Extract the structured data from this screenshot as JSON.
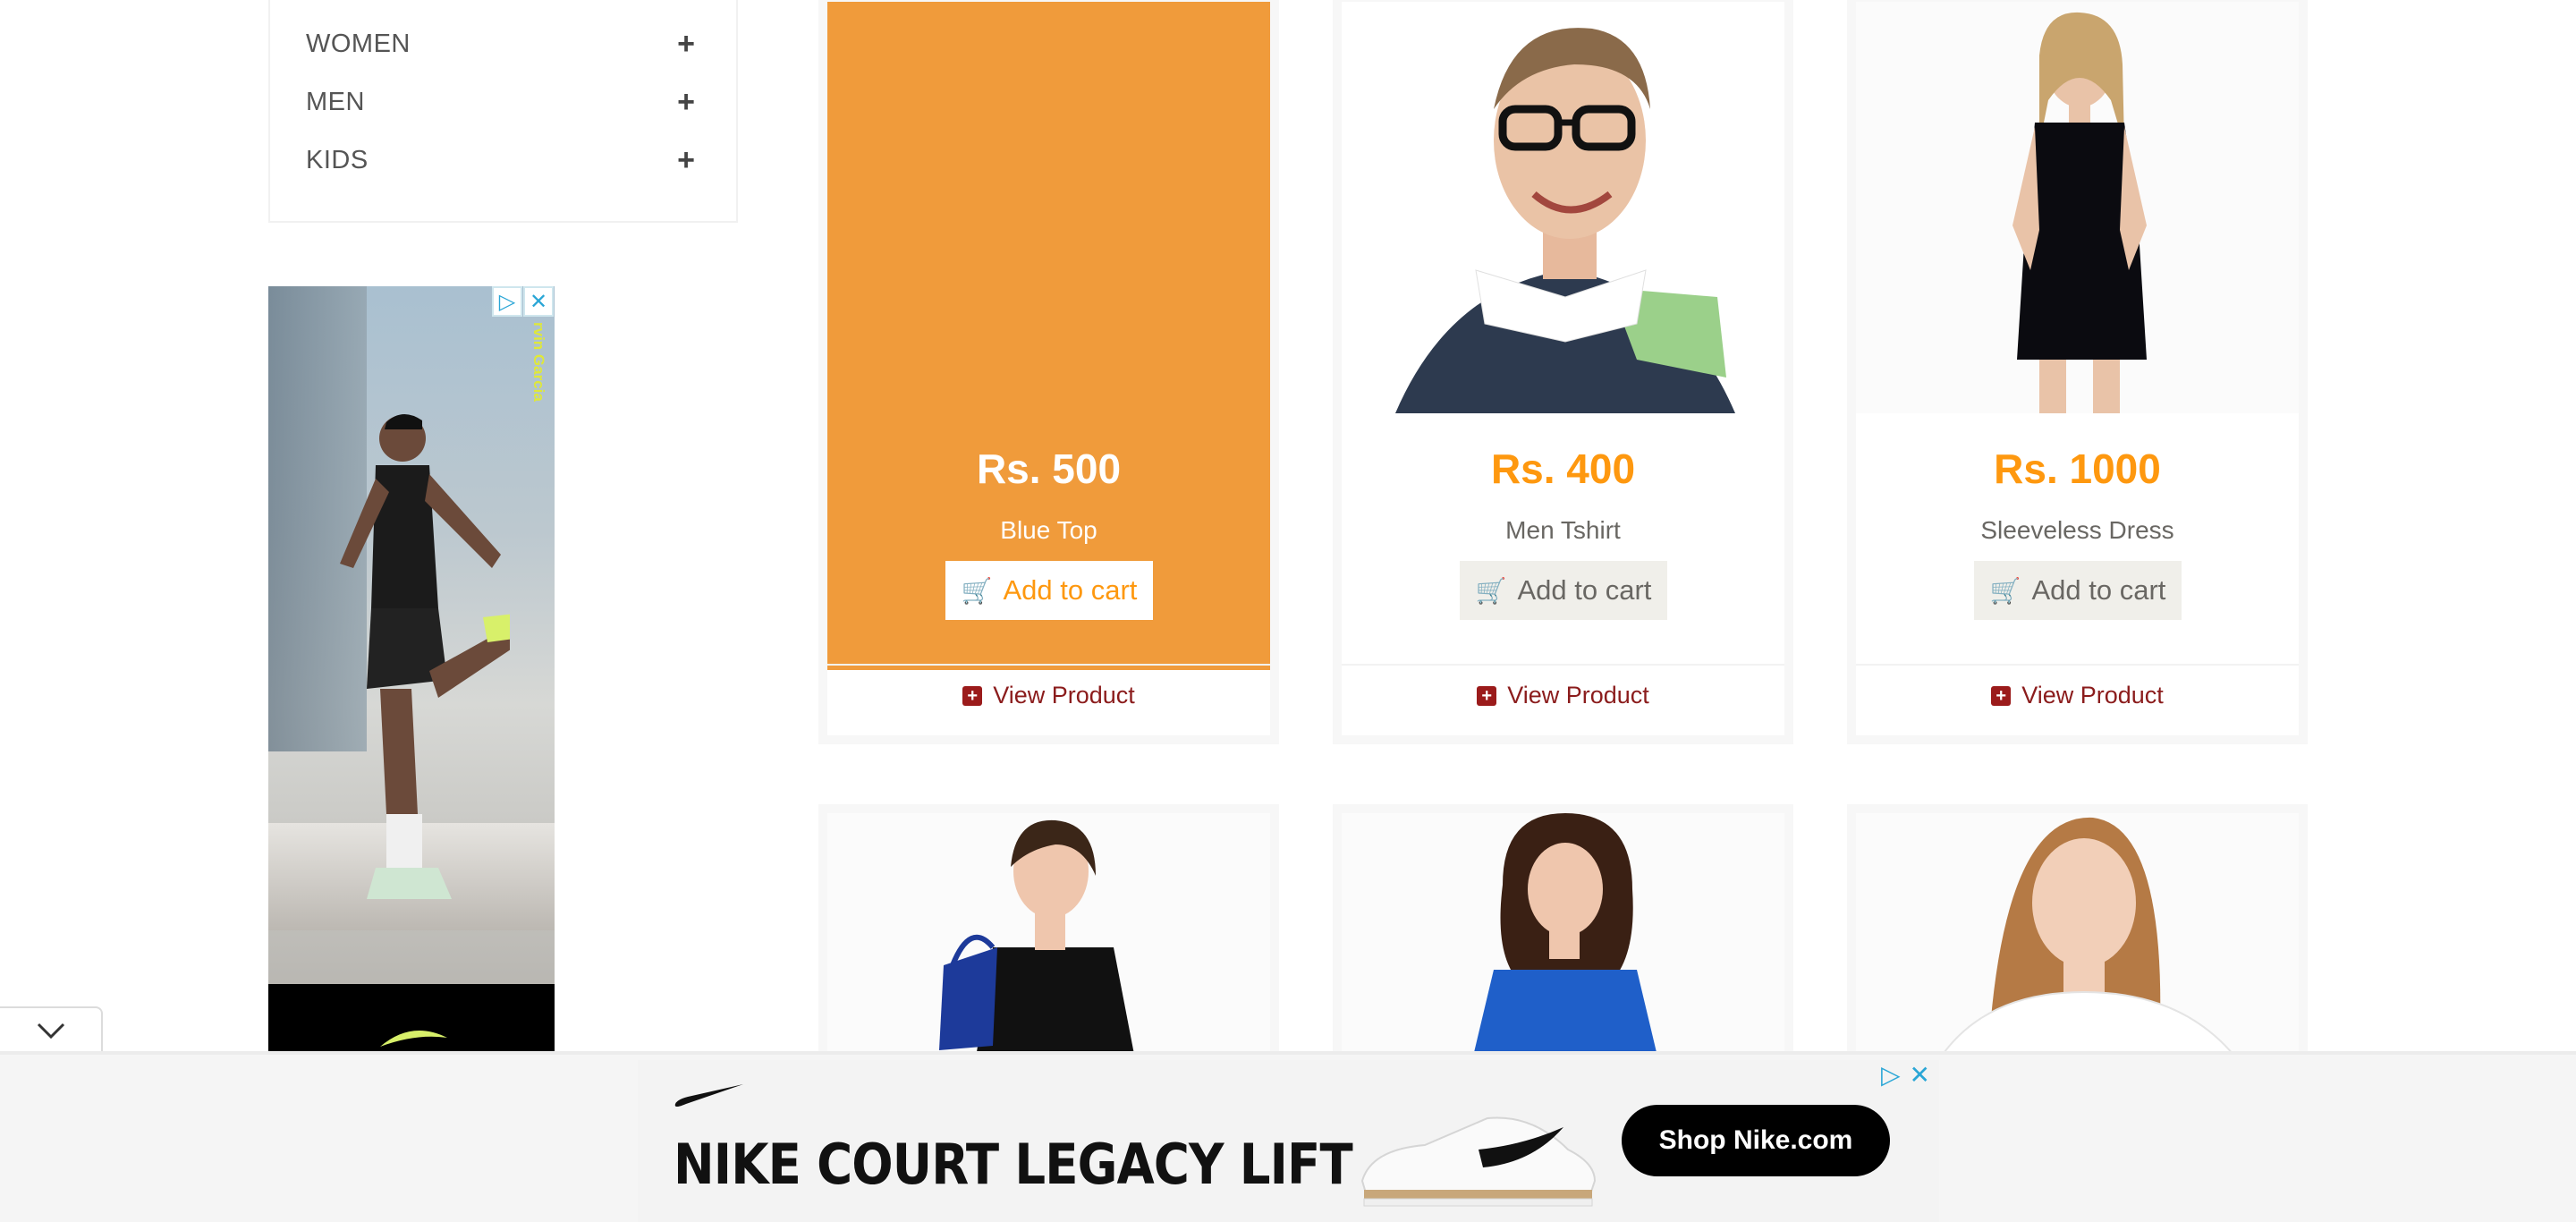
{
  "categories": [
    {
      "label": "WOMEN",
      "expand": "+"
    },
    {
      "label": "MEN",
      "expand": "+"
    },
    {
      "label": "KIDS",
      "expand": "+"
    }
  ],
  "vertical_ad": {
    "side_text": "rvin Garcia",
    "adchoices_icon": "play-triangle-icon",
    "close_icon": "close-icon"
  },
  "products": [
    {
      "price": "Rs. 500",
      "name": "Blue Top",
      "cart_label": "Add to cart",
      "view_label": "View Product",
      "state": "hovered"
    },
    {
      "price": "Rs. 400",
      "name": "Men Tshirt",
      "cart_label": "Add to cart",
      "view_label": "View Product"
    },
    {
      "price": "Rs. 1000",
      "name": "Sleeveless Dress",
      "cart_label": "Add to cart",
      "view_label": "View Product"
    }
  ],
  "bottom_ad": {
    "headline": "NIKE COURT LEGACY LIFT",
    "cta": "Shop Nike.com"
  },
  "colors": {
    "accent": "#fe980f",
    "hover_overlay": "#f09b3b",
    "view_link": "#8b1c1c"
  }
}
